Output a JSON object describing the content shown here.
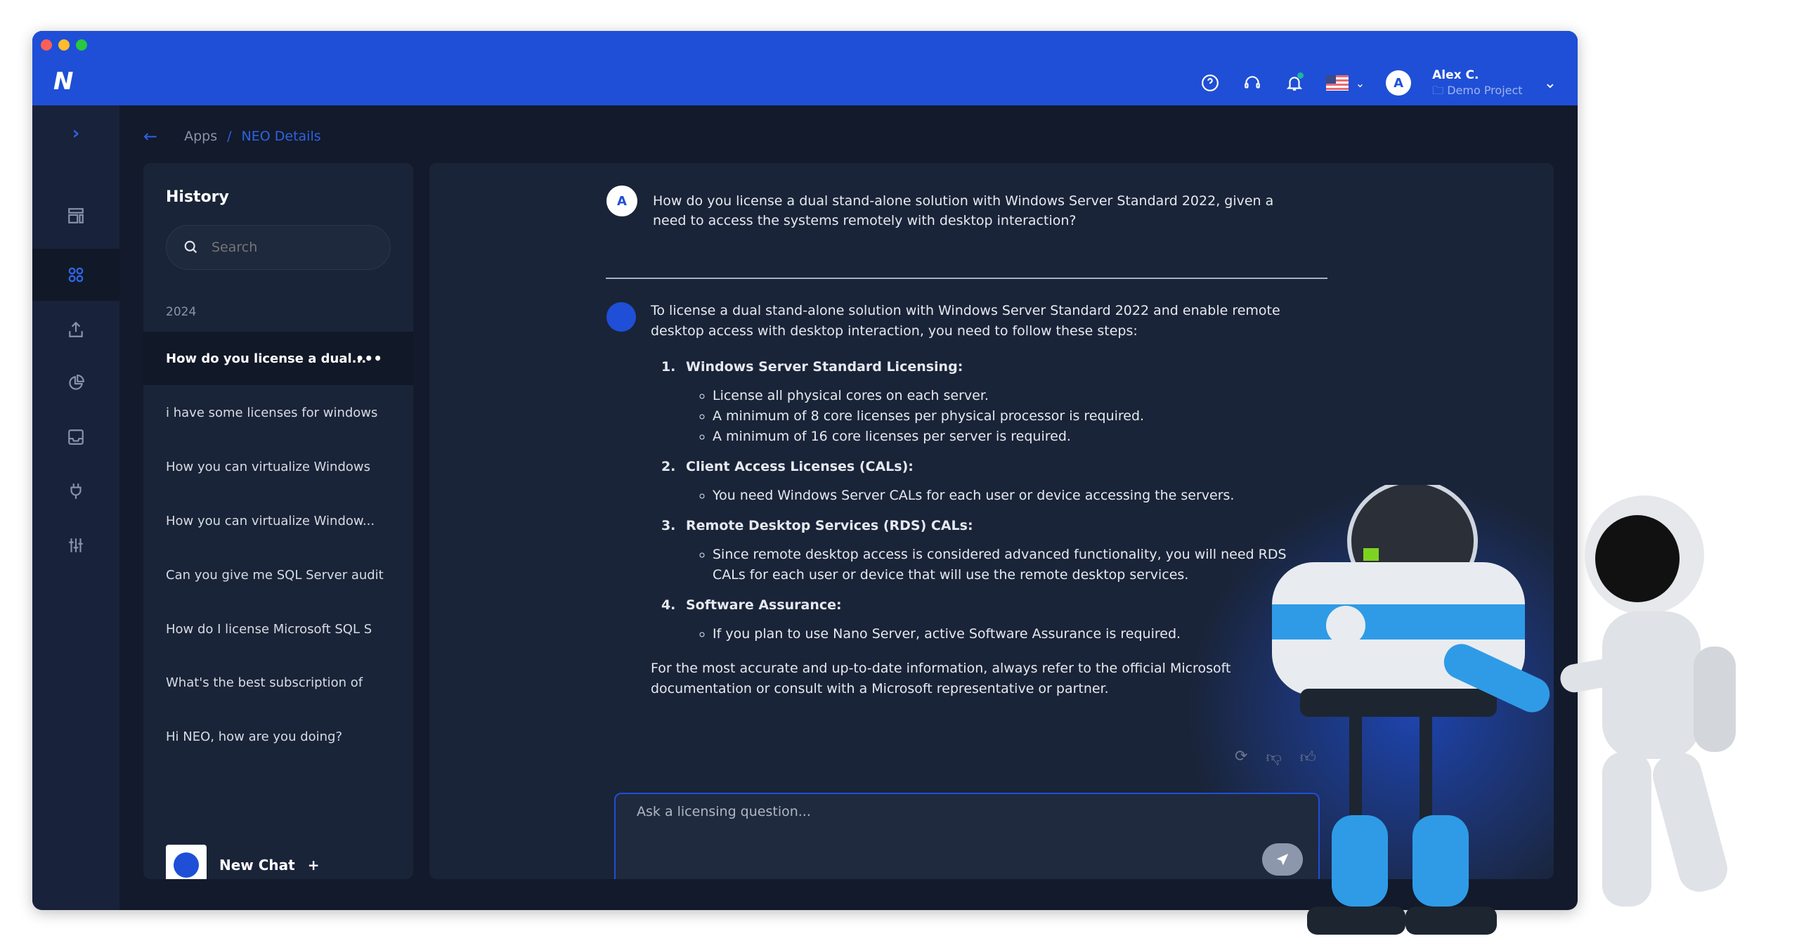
{
  "window": {
    "controls": [
      "#ff5f57",
      "#febc2e",
      "#28c840"
    ]
  },
  "header": {
    "logo": "N",
    "user": {
      "initial": "A",
      "name": "Alex C.",
      "project": "Demo Project"
    },
    "icons": [
      "help-icon",
      "headset-icon",
      "bell-icon",
      "us-flag-icon",
      "chevron-down-icon"
    ]
  },
  "rail": {
    "items": [
      "dashboard-icon",
      "apps-icon",
      "upload-icon",
      "pie-chart-icon",
      "inbox-icon",
      "plug-icon",
      "sliders-icon"
    ],
    "active": 1
  },
  "breadcrumb": {
    "root": "Apps",
    "separator": "/",
    "current": "NEO Details"
  },
  "history": {
    "title": "History",
    "search_placeholder": "Search",
    "year": "2024",
    "items": [
      "How do you license a dual...",
      "i have some licenses for windows",
      "How you can virtualize Windows",
      "How you can virtualize Window...",
      "Can you give me SQL Server audit",
      "How do I license Microsoft SQL S",
      "What's the best subscription of",
      "Hi NEO, how are you doing?"
    ],
    "more": "•••",
    "new_chat": "New Chat",
    "new_chat_plus": "+"
  },
  "chat": {
    "question": {
      "initial": "A",
      "text": "How do you license a dual stand-alone solution with Windows Server Standard 2022, given a need to access the systems remotely with desktop interaction?"
    },
    "answer": {
      "intro": "To license a dual stand-alone solution with Windows Server Standard 2022 and enable remote desktop access with desktop interaction, you need to follow these steps:",
      "steps": [
        {
          "title": "Windows Server Standard Licensing:",
          "bullets": [
            "License all physical cores on each server.",
            "A minimum of 8 core licenses per physical processor is required.",
            "A minimum of 16 core licenses per server is required."
          ]
        },
        {
          "title": "Client Access Licenses (CALs):",
          "bullets": [
            "You need Windows Server CALs for each user or device accessing the servers."
          ]
        },
        {
          "title": "Remote Desktop Services (RDS) CALs:",
          "bullets": [
            "Since remote desktop access is considered advanced functionality, you will need RDS CALs for each user or device that will use the remote desktop services."
          ]
        },
        {
          "title": "Software Assurance:",
          "bullets": [
            "If you plan to use Nano Server, active Software Assurance is required."
          ]
        }
      ],
      "outro": "For the most accurate and up-to-date information, always refer to the official Microsoft documentation or consult with a Microsoft representative or partner."
    },
    "input_placeholder": "Ask a licensing question..."
  },
  "colors": {
    "brand": "#1f4fd6",
    "background": "#121a2b",
    "panel": "#1a2438"
  }
}
